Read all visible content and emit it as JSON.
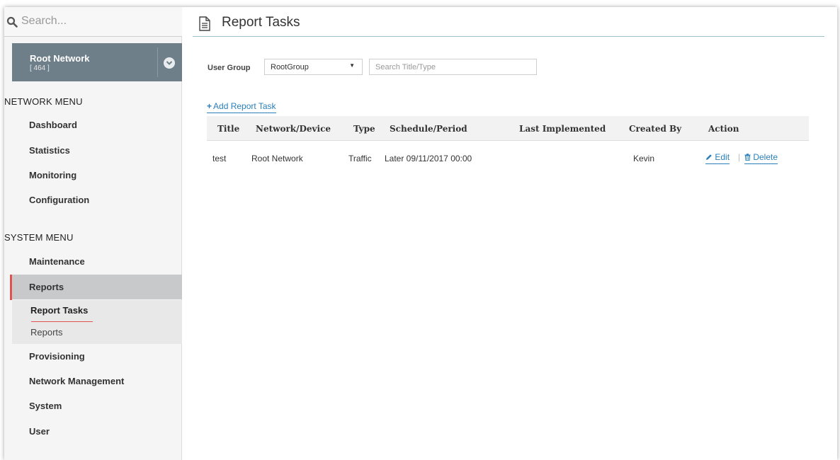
{
  "sidebar": {
    "search_placeholder": "Search...",
    "root": {
      "name": "Root Network",
      "count": "[ 464 ]"
    },
    "network_menu_header": "NETWORK MENU",
    "network_items": [
      "Dashboard",
      "Statistics",
      "Monitoring",
      "Configuration"
    ],
    "system_menu_header": "SYSTEM MENU",
    "system_items_top": [
      "Maintenance",
      "Reports"
    ],
    "active_item": "Reports",
    "sub_items": [
      "Report Tasks",
      "Reports"
    ],
    "current_sub_item": "Report Tasks",
    "system_items_bottom": [
      "Provisioning",
      "Network Management",
      "System",
      "User"
    ]
  },
  "page": {
    "title": "Report Tasks"
  },
  "filters": {
    "user_group_label": "User Group",
    "user_group_value": "RootGroup",
    "search_placeholder": "Search Title/Type"
  },
  "add_task_label": "Add Report Task",
  "table": {
    "columns": [
      "Title",
      "Network/Device",
      "Type",
      "Schedule/Period",
      "Last Implemented",
      "Created By",
      "Action"
    ],
    "rows": [
      {
        "title": "test",
        "network": "Root Network",
        "type": "Traffic",
        "schedule": "Later 09/11/2017 00:00",
        "last": "",
        "created_by": "Kevin",
        "edit": "Edit",
        "delete": "Delete"
      }
    ]
  },
  "colors": {
    "accent": "#e0534f",
    "link": "#2a7fb8",
    "root_card": "#6f7f8a"
  }
}
